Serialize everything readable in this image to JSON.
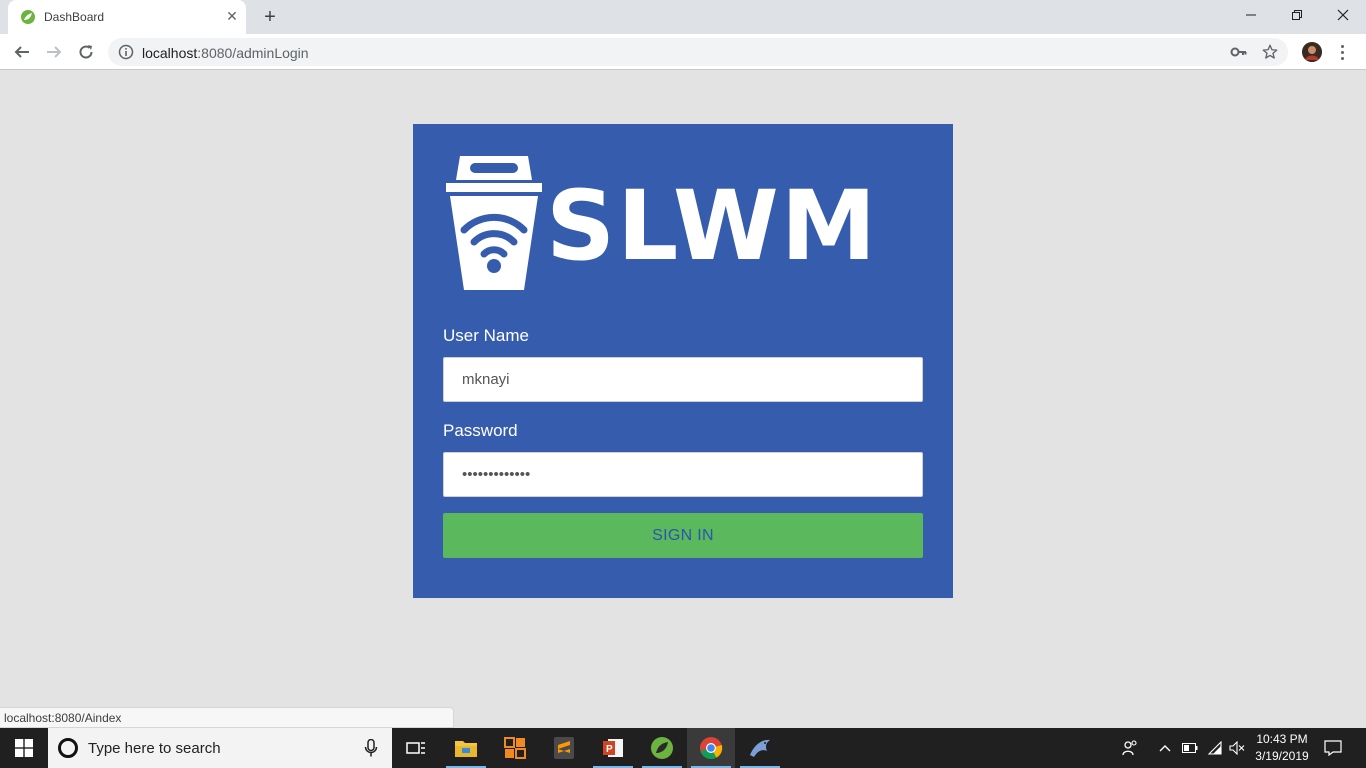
{
  "browser": {
    "tab_title": "DashBoard",
    "url_host": "localhost",
    "url_rest": ":8080/adminLogin"
  },
  "login": {
    "logo_text": "SLWM",
    "username_label": "User Name",
    "username_value": "mknayi",
    "password_label": "Password",
    "password_value": "mknayi1234567",
    "signin_label": "SIGN IN"
  },
  "status_bar": {
    "link": "localhost:8080/Aindex"
  },
  "taskbar": {
    "search_placeholder": "Type here to search",
    "time": "10:43 PM",
    "date": "3/19/2019"
  },
  "colors": {
    "card": "#365cad",
    "signin": "#5cb85c",
    "signin_text": "#2a56b0",
    "page_bg": "#e3e3e3"
  }
}
